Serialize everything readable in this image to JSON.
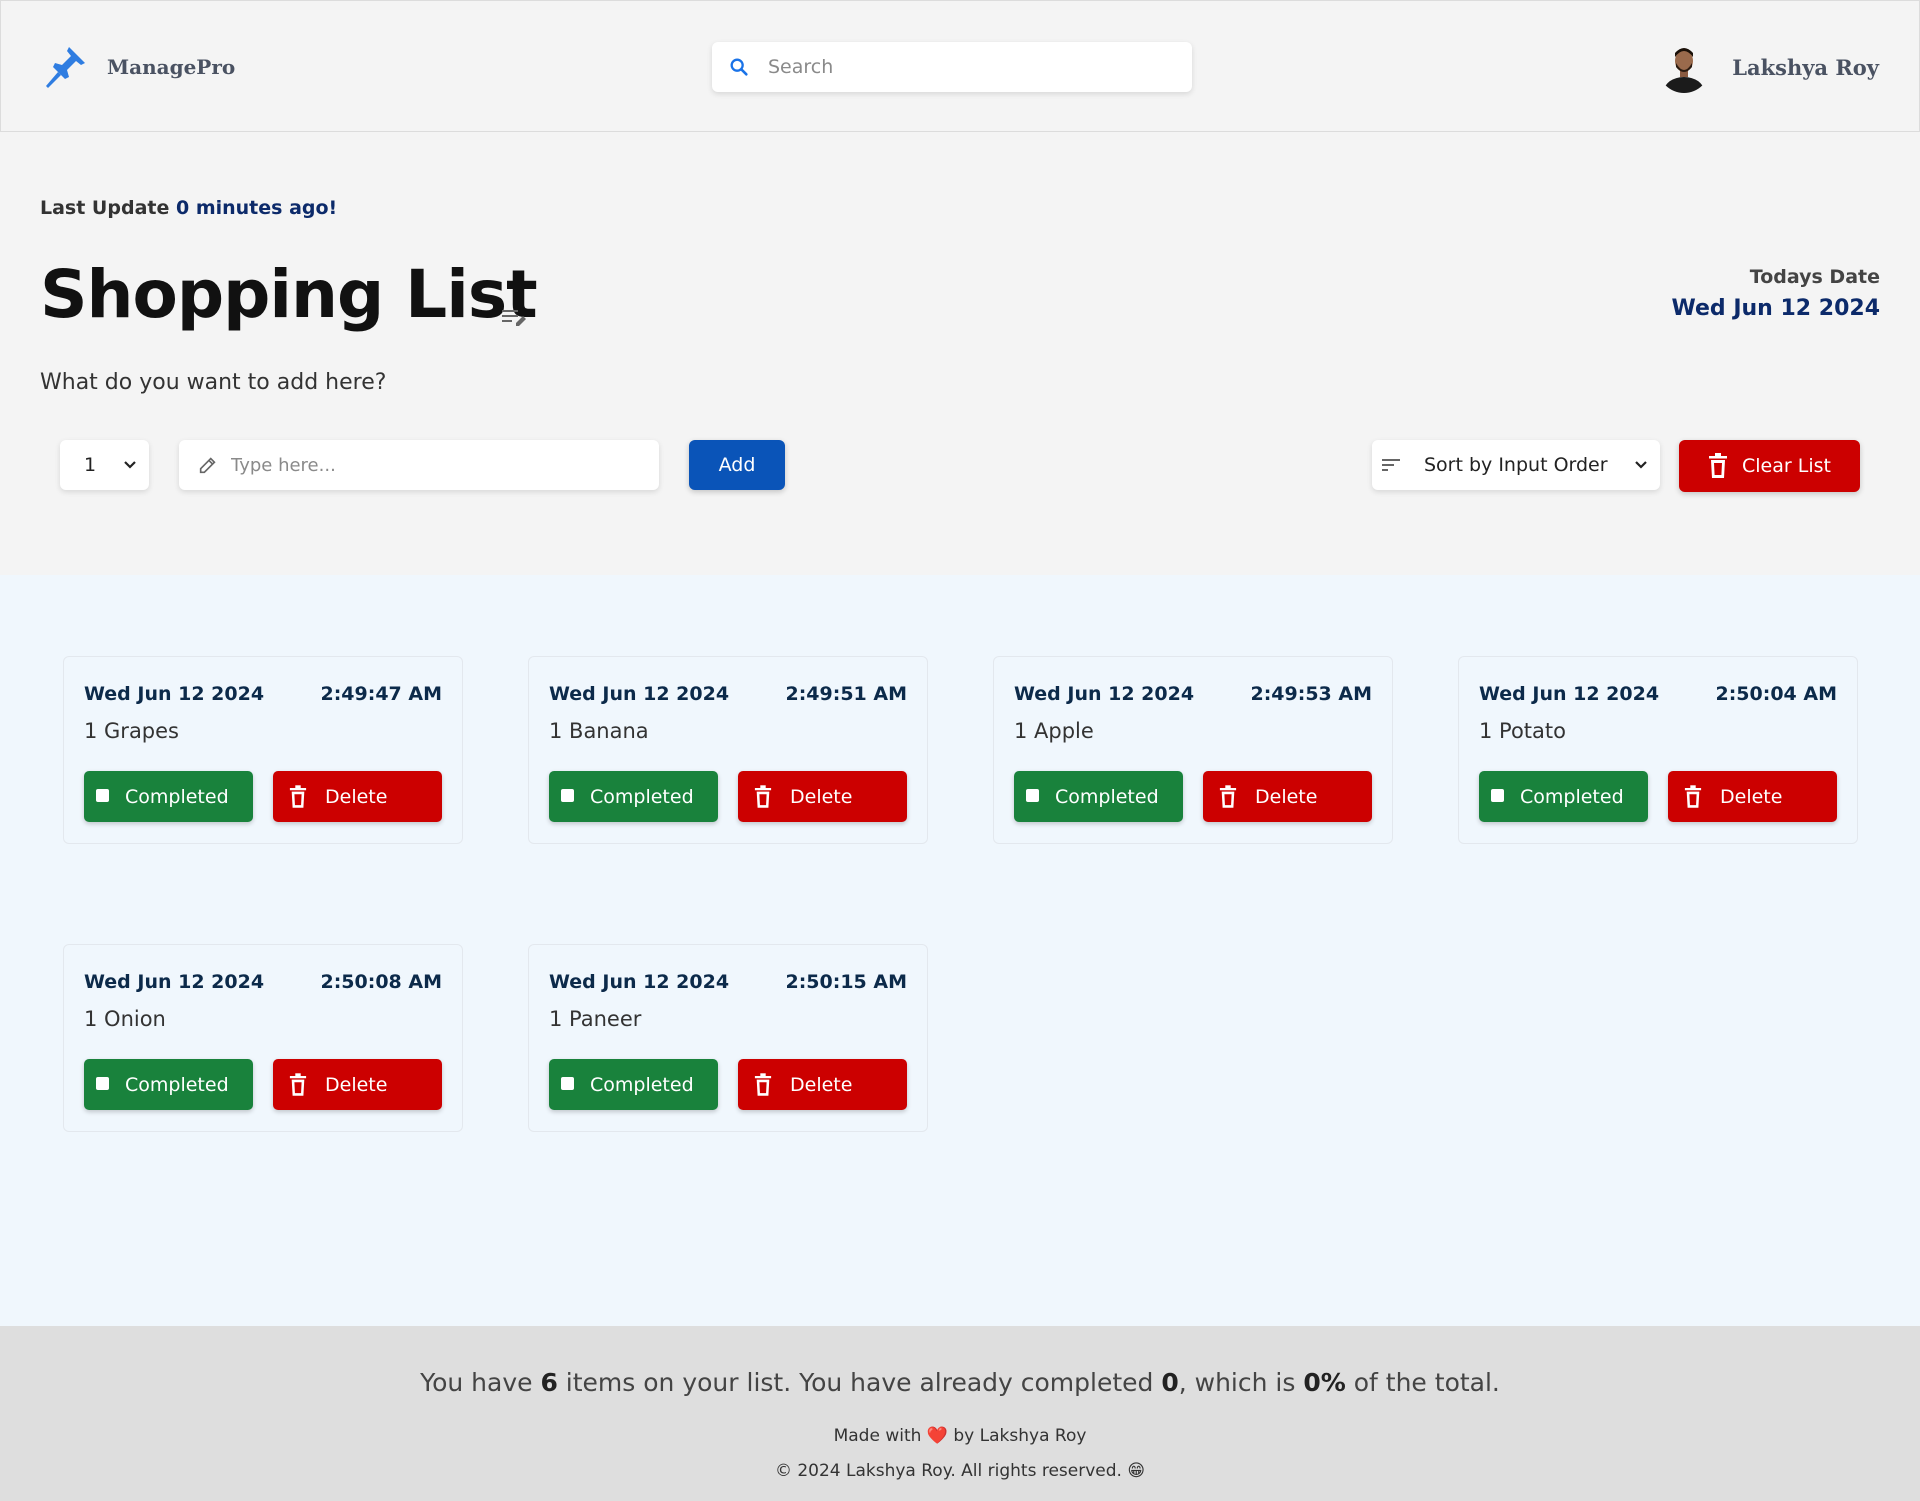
{
  "header": {
    "brand": "ManagePro",
    "search_placeholder": "Search",
    "user_name": "Lakshya Roy"
  },
  "status": {
    "last_update_prefix": "Last Update",
    "last_update_value": "0 minutes ago!"
  },
  "page": {
    "title": "Shopping List",
    "todays_label": "Todays Date",
    "todays_date": "Wed Jun 12 2024",
    "prompt": "What do you want to add here?"
  },
  "controls": {
    "quantity": "1",
    "input_placeholder": "Type here...",
    "add_label": "Add",
    "sort_label": "Sort by Input Order",
    "clear_label": "Clear List"
  },
  "items": [
    {
      "date": "Wed Jun 12 2024",
      "time": "2:49:47 AM",
      "name": "1 Grapes",
      "completed_label": "Completed",
      "delete_label": "Delete"
    },
    {
      "date": "Wed Jun 12 2024",
      "time": "2:49:51 AM",
      "name": "1 Banana",
      "completed_label": "Completed",
      "delete_label": "Delete"
    },
    {
      "date": "Wed Jun 12 2024",
      "time": "2:49:53 AM",
      "name": "1 Apple",
      "completed_label": "Completed",
      "delete_label": "Delete"
    },
    {
      "date": "Wed Jun 12 2024",
      "time": "2:50:04 AM",
      "name": "1 Potato",
      "completed_label": "Completed",
      "delete_label": "Delete"
    },
    {
      "date": "Wed Jun 12 2024",
      "time": "2:50:08 AM",
      "name": "1 Onion",
      "completed_label": "Completed",
      "delete_label": "Delete"
    },
    {
      "date": "Wed Jun 12 2024",
      "time": "2:50:15 AM",
      "name": "1 Paneer",
      "completed_label": "Completed",
      "delete_label": "Delete"
    }
  ],
  "footer": {
    "summary_a": "You have ",
    "item_count": "6",
    "summary_b": " items on your list. You have already completed ",
    "completed_count": "0",
    "summary_c": ", which is ",
    "percent": "0%",
    "summary_d": " of the total.",
    "made_with_a": "Made with",
    "heart": "❤️",
    "made_with_b": "by Lakshya Roy",
    "copyright": "© 2024 Lakshya Roy. All rights reserved. 😁"
  },
  "colors": {
    "primary": "#0a54b8",
    "success": "#19823c",
    "danger": "#cc0000",
    "heading_navy": "#0c2a4a"
  }
}
